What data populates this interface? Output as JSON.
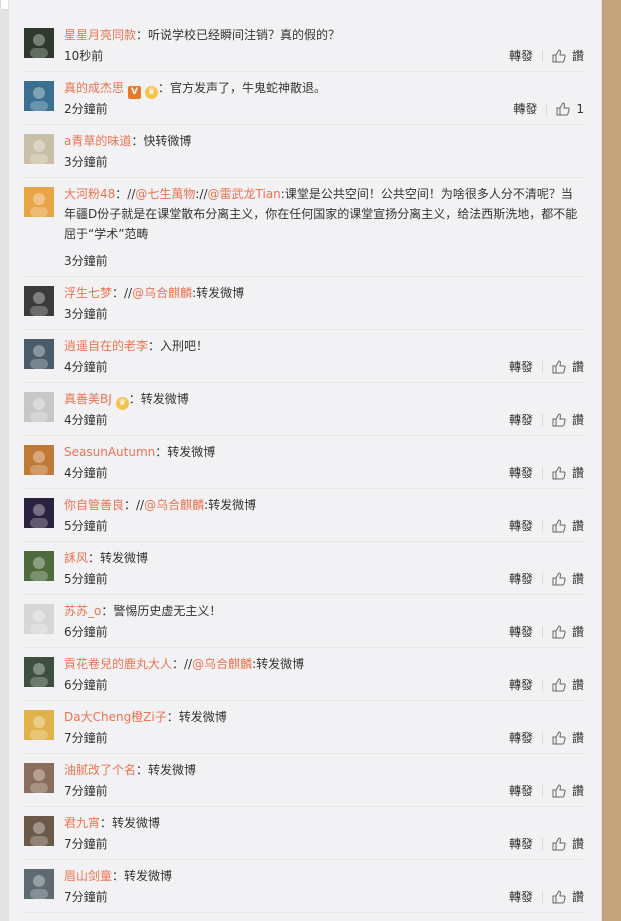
{
  "ui": {
    "repost_label": "轉發",
    "like_label": "讚"
  },
  "comments": [
    {
      "user": "星星月亮同款",
      "badges": [],
      "body": "：听说学校已经瞬间注销？真的假的？",
      "time": "10秒前",
      "actions": true,
      "like": "讚",
      "avatar": "#2e3b2c"
    },
    {
      "user": "真的成杰思",
      "badges": [
        "v",
        "crown"
      ],
      "body": "：官方发声了，牛鬼蛇神散退。",
      "time": "2分鐘前",
      "actions": true,
      "like": "1",
      "avatar": "#3a6f8f"
    },
    {
      "user": "a青草的味道",
      "badges": [],
      "body": "：快转微博",
      "time": "3分鐘前",
      "actions": false,
      "avatar": "#c9bfa6"
    },
    {
      "user": "大河粉48",
      "badges": [],
      "body_parts": [
        {
          "t": "：//"
        },
        {
          "m": "@七生萬物"
        },
        {
          "t": ":"
        },
        {
          "t": "//"
        },
        {
          "m": "@雷武龙Tian"
        },
        {
          "t": ":课堂是公共空间！公共空间！为啥很多人分不清呢？当年疆D份子就是在课堂散布分离主义，你在任何国家的课堂宣扬分离主义，给法西斯洗地，都不能屈于“学术”范畴"
        }
      ],
      "time": "3分鐘前",
      "actions": false,
      "tall": true,
      "avatar": "#e8a546"
    },
    {
      "user": "浮生七梦",
      "badges": [],
      "body_parts": [
        {
          "t": "：//"
        },
        {
          "m": "@乌合麒麟"
        },
        {
          "t": ":转发微博"
        }
      ],
      "time": "3分鐘前",
      "actions": false,
      "avatar": "#3b3b3b"
    },
    {
      "user": "逍遥自在的老李",
      "badges": [],
      "body": "：入刑吧！",
      "time": "4分鐘前",
      "actions": true,
      "like": "讚",
      "avatar": "#4a5b6a"
    },
    {
      "user": "真善美BJ",
      "badges": [
        "crown"
      ],
      "body": "：转发微博",
      "time": "4分鐘前",
      "actions": true,
      "like": "讚",
      "avatar": "#c7c7c7"
    },
    {
      "user": "SeasunAutumn",
      "badges": [],
      "body": "：转发微博",
      "time": "4分鐘前",
      "actions": true,
      "like": "讚",
      "avatar": "#c07a36"
    },
    {
      "user": "你自管善良",
      "badges": [],
      "body_parts": [
        {
          "t": "：//"
        },
        {
          "m": "@乌合麒麟"
        },
        {
          "t": ":转发微博"
        }
      ],
      "time": "5分鐘前",
      "actions": true,
      "like": "讚",
      "avatar": "#2b2240"
    },
    {
      "user": "訸风",
      "badges": [],
      "body": "：转发微博",
      "time": "5分鐘前",
      "actions": true,
      "like": "讚",
      "avatar": "#4f6b3d"
    },
    {
      "user": "苏苏_o",
      "badges": [],
      "body": "：警惕历史虚无主义！",
      "time": "6分鐘前",
      "actions": true,
      "like": "讚",
      "avatar": "#d6d6d6"
    },
    {
      "user": "貢花卷兒的鹿丸大人",
      "badges": [],
      "body_parts": [
        {
          "t": "：//"
        },
        {
          "m": "@乌合麒麟"
        },
        {
          "t": ":转发微博"
        }
      ],
      "time": "6分鐘前",
      "actions": true,
      "like": "讚",
      "avatar": "#3d4f3e"
    },
    {
      "user": "Da大Cheng橙Zi子",
      "badges": [],
      "body": "：转发微博",
      "time": "7分鐘前",
      "actions": true,
      "like": "讚",
      "avatar": "#e0b24a"
    },
    {
      "user": "油腻改了个名",
      "badges": [],
      "body": "：转发微博",
      "time": "7分鐘前",
      "actions": true,
      "like": "讚",
      "avatar": "#8a6d5a"
    },
    {
      "user": "君九宵",
      "badges": [],
      "body": "：转发微博",
      "time": "7分鐘前",
      "actions": true,
      "like": "讚",
      "avatar": "#6b5a4a"
    },
    {
      "user": "眉山剑童",
      "badges": [],
      "body": "：转发微博",
      "time": "7分鐘前",
      "actions": true,
      "like": "讚",
      "avatar": "#5e6a72"
    }
  ]
}
